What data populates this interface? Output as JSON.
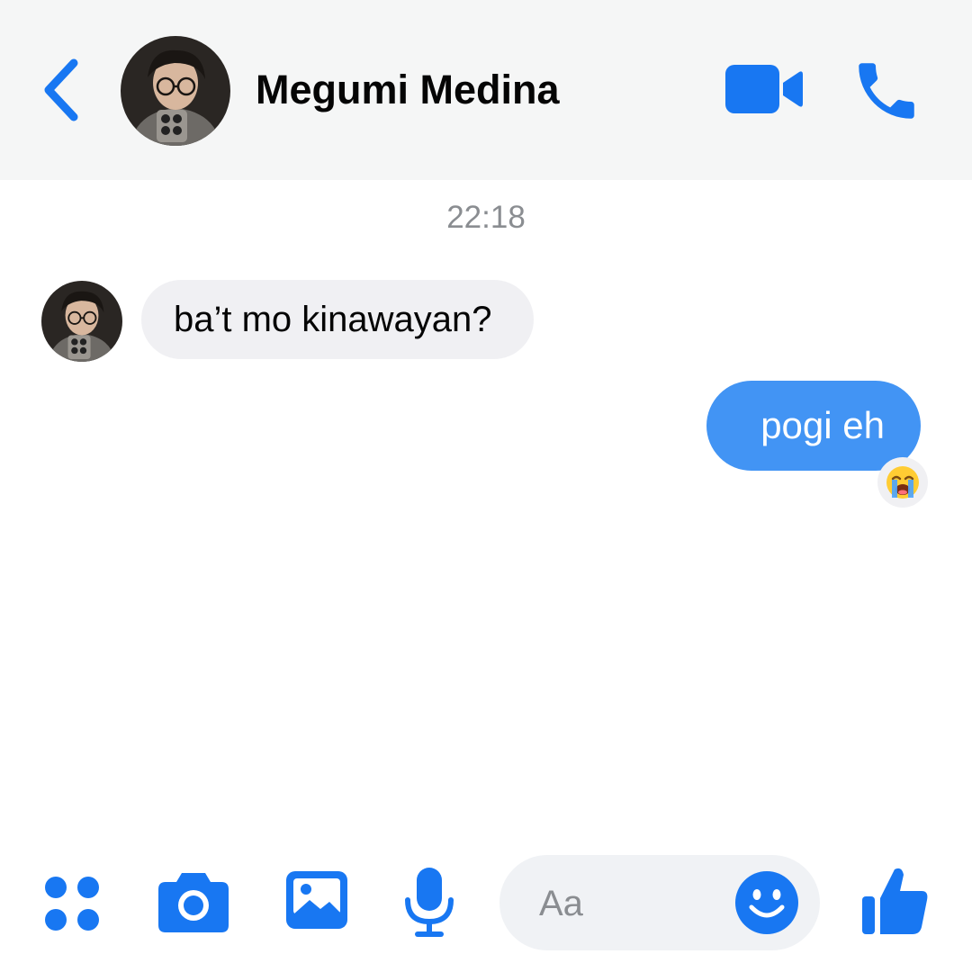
{
  "header": {
    "contact_name": "Megumi Medina",
    "icons": {
      "back": "chevron-left-icon",
      "video": "video-camera-icon",
      "call": "phone-icon"
    }
  },
  "conversation": {
    "timestamp": "22:18",
    "messages": [
      {
        "direction": "incoming",
        "text": "ba’t mo kinawayan?"
      },
      {
        "direction": "outgoing",
        "text": "pogi eh",
        "reaction": "😭"
      }
    ]
  },
  "composer": {
    "placeholder": "Aa",
    "icons": [
      "apps-icon",
      "camera-icon",
      "gallery-icon",
      "microphone-icon",
      "emoji-icon",
      "thumbs-up-icon"
    ]
  },
  "colors": {
    "accent": "#1877f2",
    "outgoing_bubble": "#4294f4",
    "incoming_bubble": "#f0f0f3",
    "header_bg": "#f5f6f6",
    "timestamp": "#8a8d91"
  }
}
